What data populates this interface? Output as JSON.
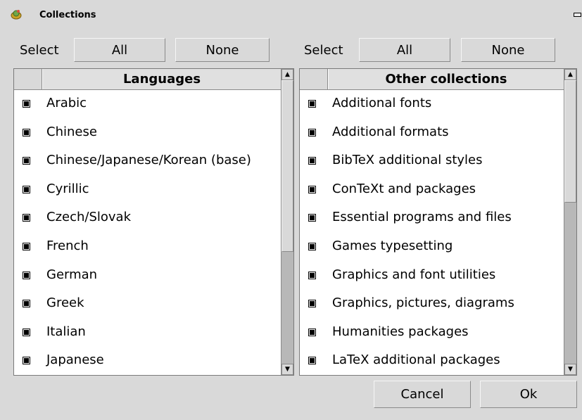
{
  "window": {
    "title": "Collections"
  },
  "left_panel": {
    "select_label": "Select",
    "all_label": "All",
    "none_label": "None",
    "header": "Languages",
    "items": [
      "Arabic",
      "Chinese",
      "Chinese/Japanese/Korean (base)",
      "Cyrillic",
      "Czech/Slovak",
      "French",
      "German",
      "Greek",
      "Italian",
      "Japanese"
    ]
  },
  "right_panel": {
    "select_label": "Select",
    "all_label": "All",
    "none_label": "None",
    "header": "Other collections",
    "items": [
      "Additional fonts",
      "Additional formats",
      "BibTeX additional styles",
      "ConTeXt and packages",
      "Essential programs and files",
      "Games typesetting",
      "Graphics and font utilities",
      "Graphics, pictures, diagrams",
      "Humanities packages",
      "LaTeX additional packages"
    ]
  },
  "footer": {
    "cancel_label": "Cancel",
    "ok_label": "Ok"
  },
  "icons": {
    "app": "collections-app-icon",
    "checkbox": "checked-checkbox-icon",
    "scroll_up": "scroll-up-arrow-icon",
    "scroll_down": "scroll-down-arrow-icon",
    "window_control": "window-maximize-icon"
  },
  "colors": {
    "background": "#d9d9d9",
    "list_background": "#ffffff",
    "scroll_track": "#b8b8b8"
  }
}
